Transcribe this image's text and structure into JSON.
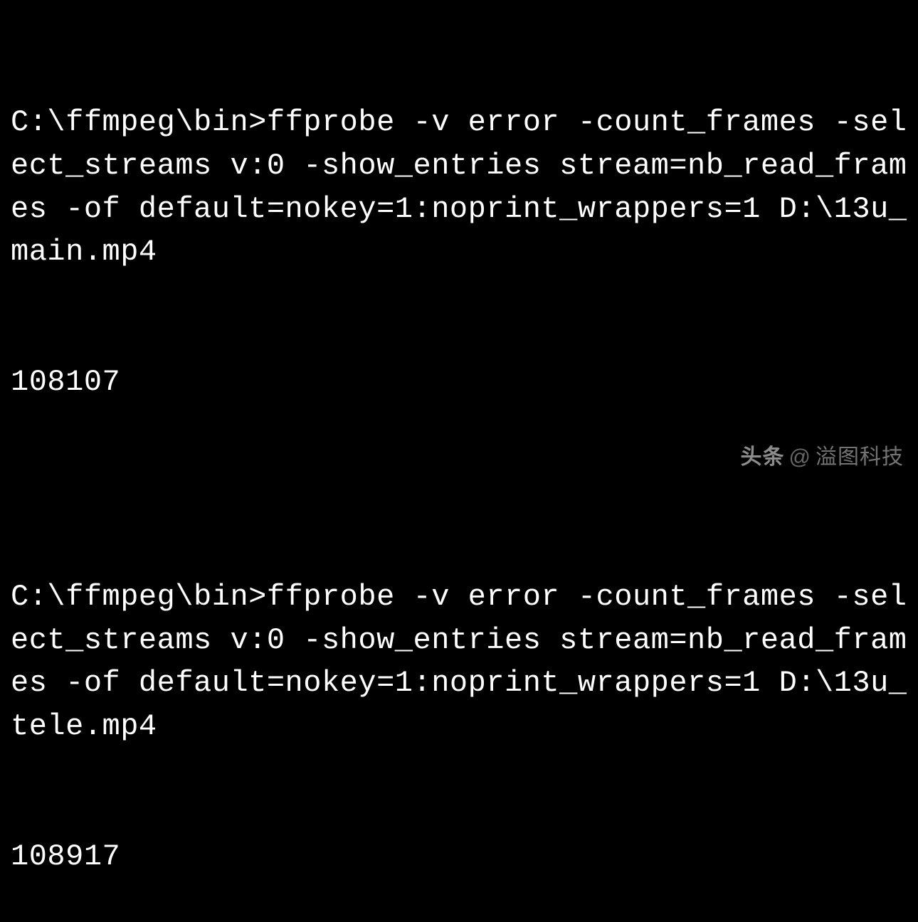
{
  "terminal": {
    "blocks": [
      {
        "prompt": "C:\\ffmpeg\\bin>",
        "command": "ffprobe -v error -count_frames -select_streams v:0 -show_entries stream=nb_read_frames -of default=nokey=1:noprint_wrappers=1 D:\\13u_main.mp4",
        "output": "108107"
      },
      {
        "prompt": "C:\\ffmpeg\\bin>",
        "command": "ffprobe -v error -count_frames -select_streams v:0 -show_entries stream=nb_read_frames -of default=nokey=1:noprint_wrappers=1 D:\\13u_tele.mp4",
        "output": "108917"
      }
    ]
  },
  "watermark": {
    "brand": "头条",
    "at": "@",
    "author": "溢图科技"
  }
}
